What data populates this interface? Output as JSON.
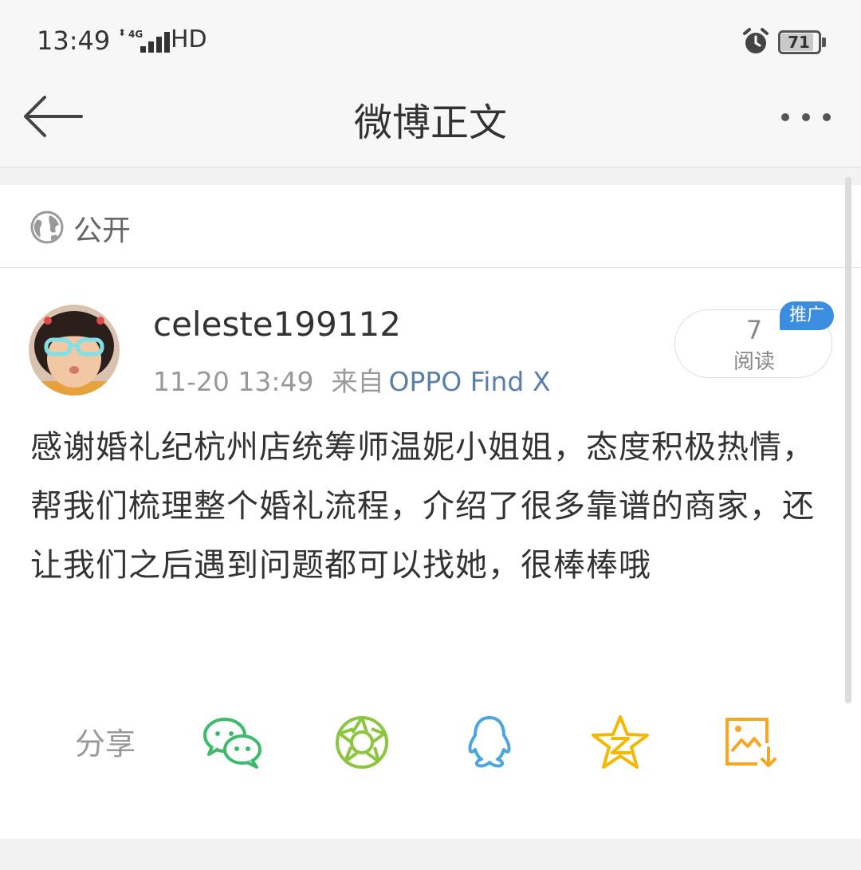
{
  "status_bar": {
    "time": "13:49",
    "network": "4G",
    "hd": "HD",
    "battery": "71",
    "icons": [
      "signal-icon",
      "alarm-icon",
      "battery-icon"
    ]
  },
  "header": {
    "title": "微博正文",
    "back_icon": "arrow-left-icon",
    "more_icon": "more-dots-icon"
  },
  "post": {
    "visibility": "公开",
    "author": "celeste199112",
    "timestamp": "11-20 13:49",
    "source_label": "来自",
    "source": "OPPO Find X",
    "read_count": "7",
    "read_label": "阅读",
    "promo_badge": "推广",
    "text": "感谢婚礼纪杭州店统筹师温妮小姐姐，态度积极热情，帮我们梳理整个婚礼流程，介绍了很多靠谱的商家，还让我们之后遇到问题都可以找她，很棒棒哦"
  },
  "share": {
    "label": "分享",
    "targets": [
      "wechat-icon",
      "moments-icon",
      "qq-icon",
      "qzone-icon",
      "save-image-icon"
    ]
  },
  "colors": {
    "wechat": "#3dba6c",
    "moments": "#8cc63f",
    "qq": "#4ba6e0",
    "qzone": "#f5b800",
    "save": "#f5a623",
    "link": "#5b7fa8",
    "promo": "#3b8de0"
  }
}
